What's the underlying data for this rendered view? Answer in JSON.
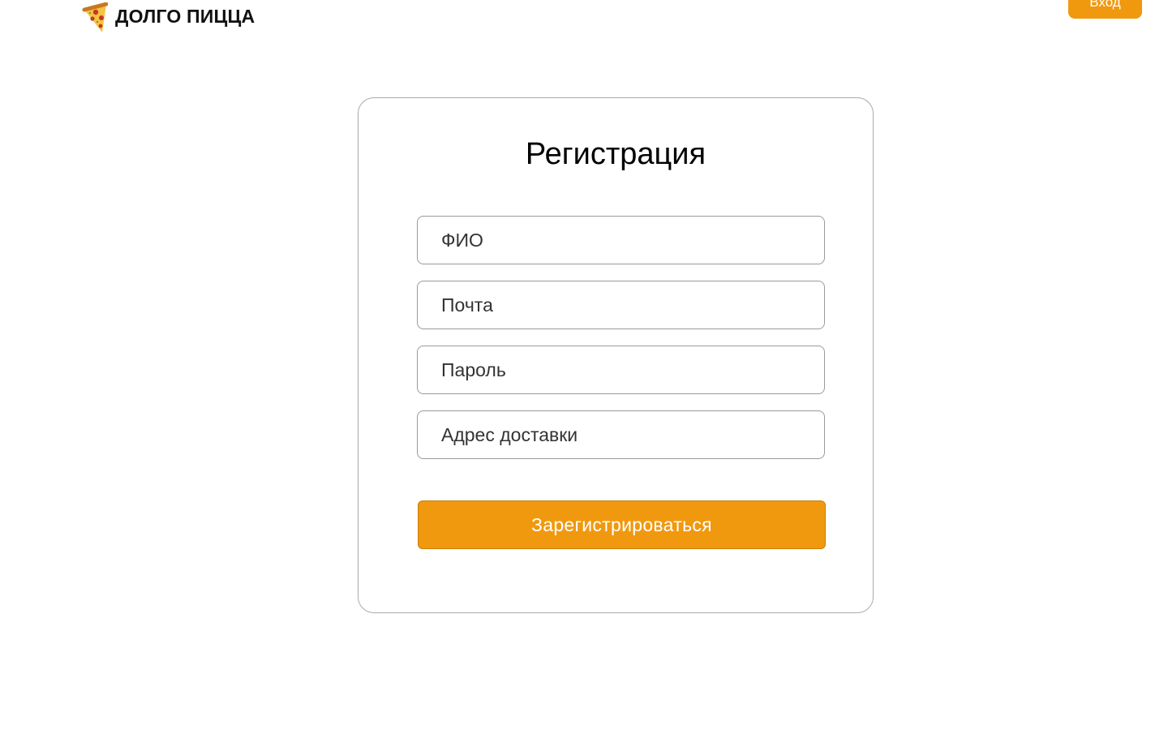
{
  "header": {
    "brand": "ДОЛГО ПИЦЦА",
    "logo_icon": "pizza-slice-icon",
    "login_label": "Вход"
  },
  "registration": {
    "title": "Регистрация",
    "fields": [
      {
        "placeholder": "ФИО",
        "value": ""
      },
      {
        "placeholder": "Почта",
        "value": ""
      },
      {
        "placeholder": "Пароль",
        "value": ""
      },
      {
        "placeholder": "Адрес доставки",
        "value": ""
      }
    ],
    "submit_label": "Зарегистрироваться"
  },
  "colors": {
    "accent": "#f0990f",
    "border": "#a9a9a9",
    "text": "#111111"
  }
}
